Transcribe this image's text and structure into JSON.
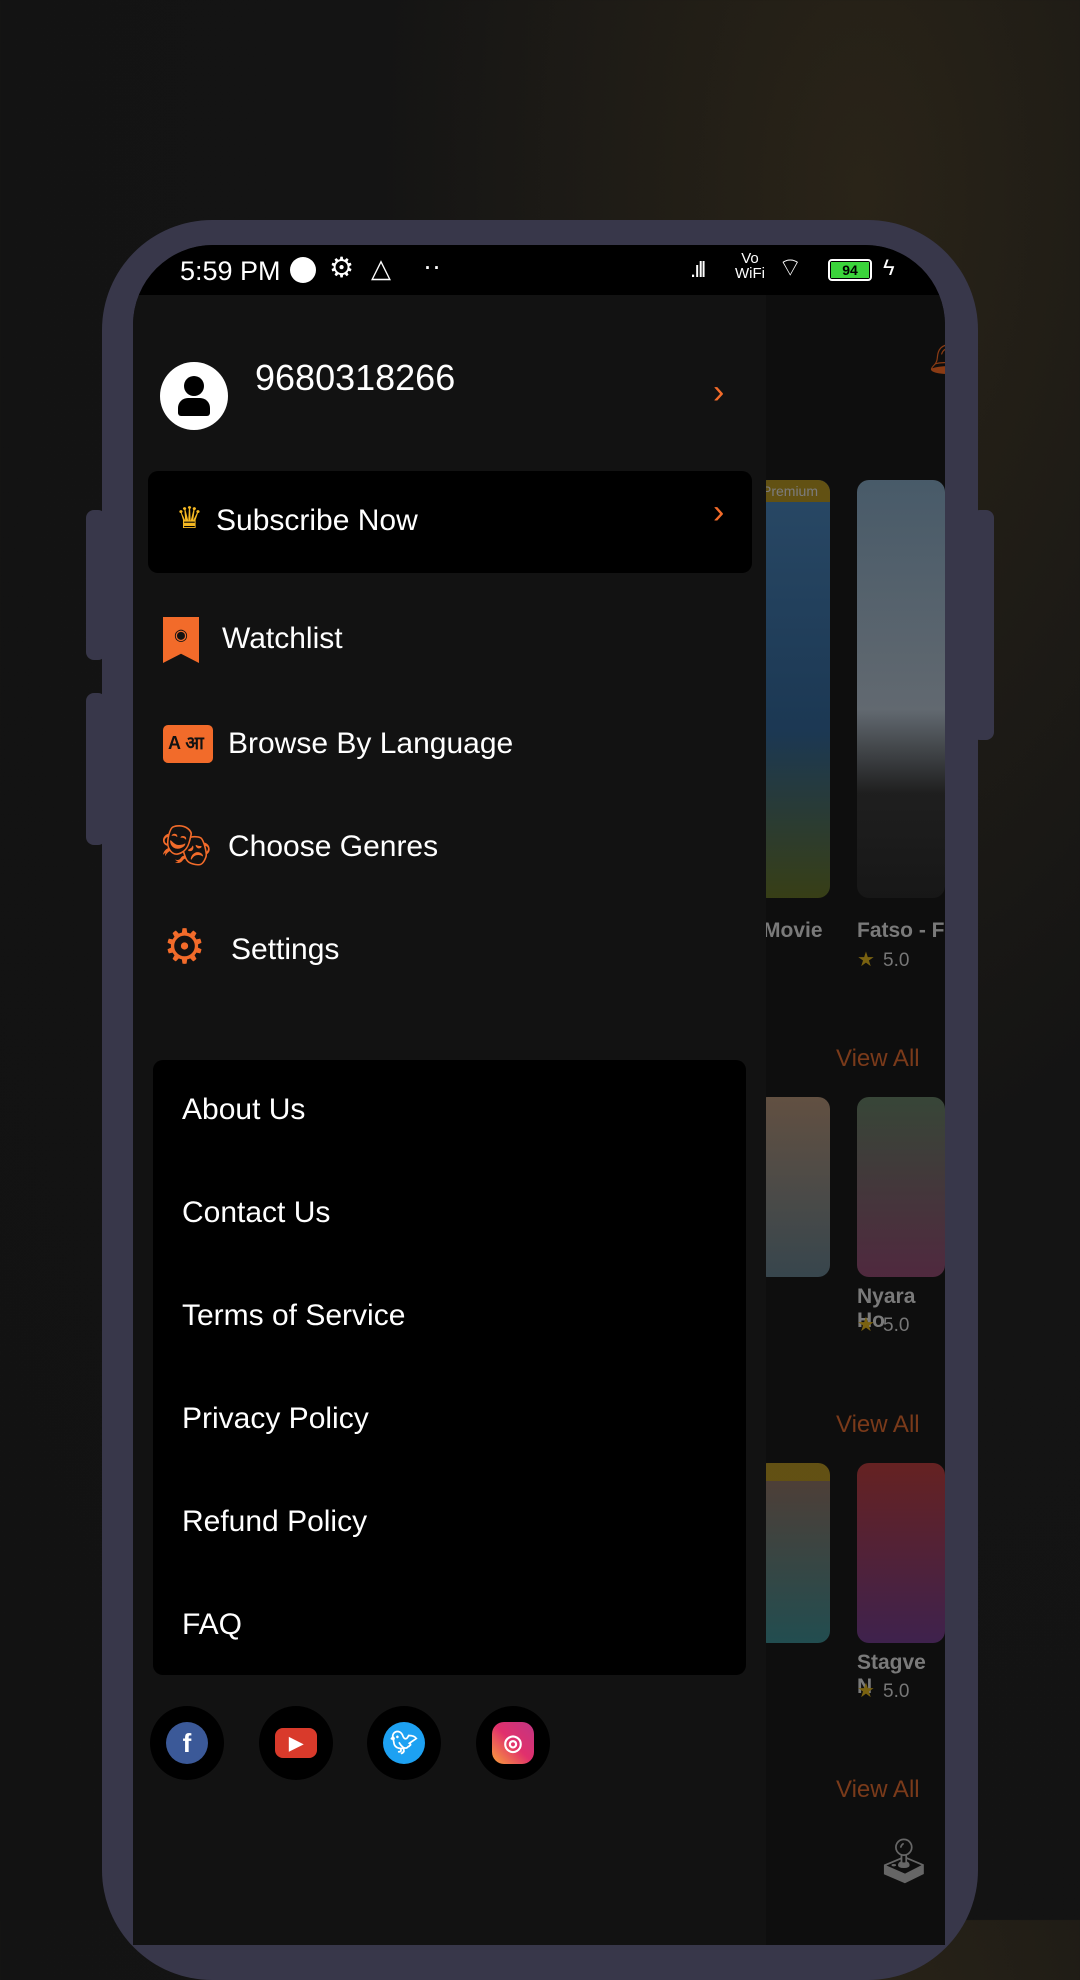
{
  "status_bar": {
    "time": "5:59 PM",
    "vowifi_top": "Vo",
    "vowifi_bottom": "WiFi",
    "battery": "94"
  },
  "drawer": {
    "phone_number": "9680318266",
    "subscribe_label": "Subscribe Now",
    "items": [
      {
        "label": "Watchlist",
        "icon": "bookmark-eye-icon"
      },
      {
        "label": "Browse By Language",
        "icon": "language-icon"
      },
      {
        "label": "Choose Genres",
        "icon": "theater-masks-icon"
      },
      {
        "label": "Settings",
        "icon": "gear-icon"
      }
    ],
    "links": [
      "About Us",
      "Contact Us",
      "Terms of Service",
      "Privacy Policy",
      "Refund Policy",
      "FAQ"
    ],
    "social": [
      "facebook",
      "youtube",
      "twitter",
      "instagram"
    ]
  },
  "background_content": {
    "badge": "Premium",
    "row1": {
      "title_left": "Movie",
      "title_right": "Fatso - F",
      "rating": "5.0"
    },
    "row2": {
      "title_right": "Nyara Ho",
      "rating": "5.0"
    },
    "row3": {
      "title_right": "Stagve N",
      "rating": "5.0"
    },
    "view_all": "View All"
  },
  "colors": {
    "accent": "#f26b2a",
    "drawer_bg": "#121212",
    "frame": "#38374a"
  }
}
